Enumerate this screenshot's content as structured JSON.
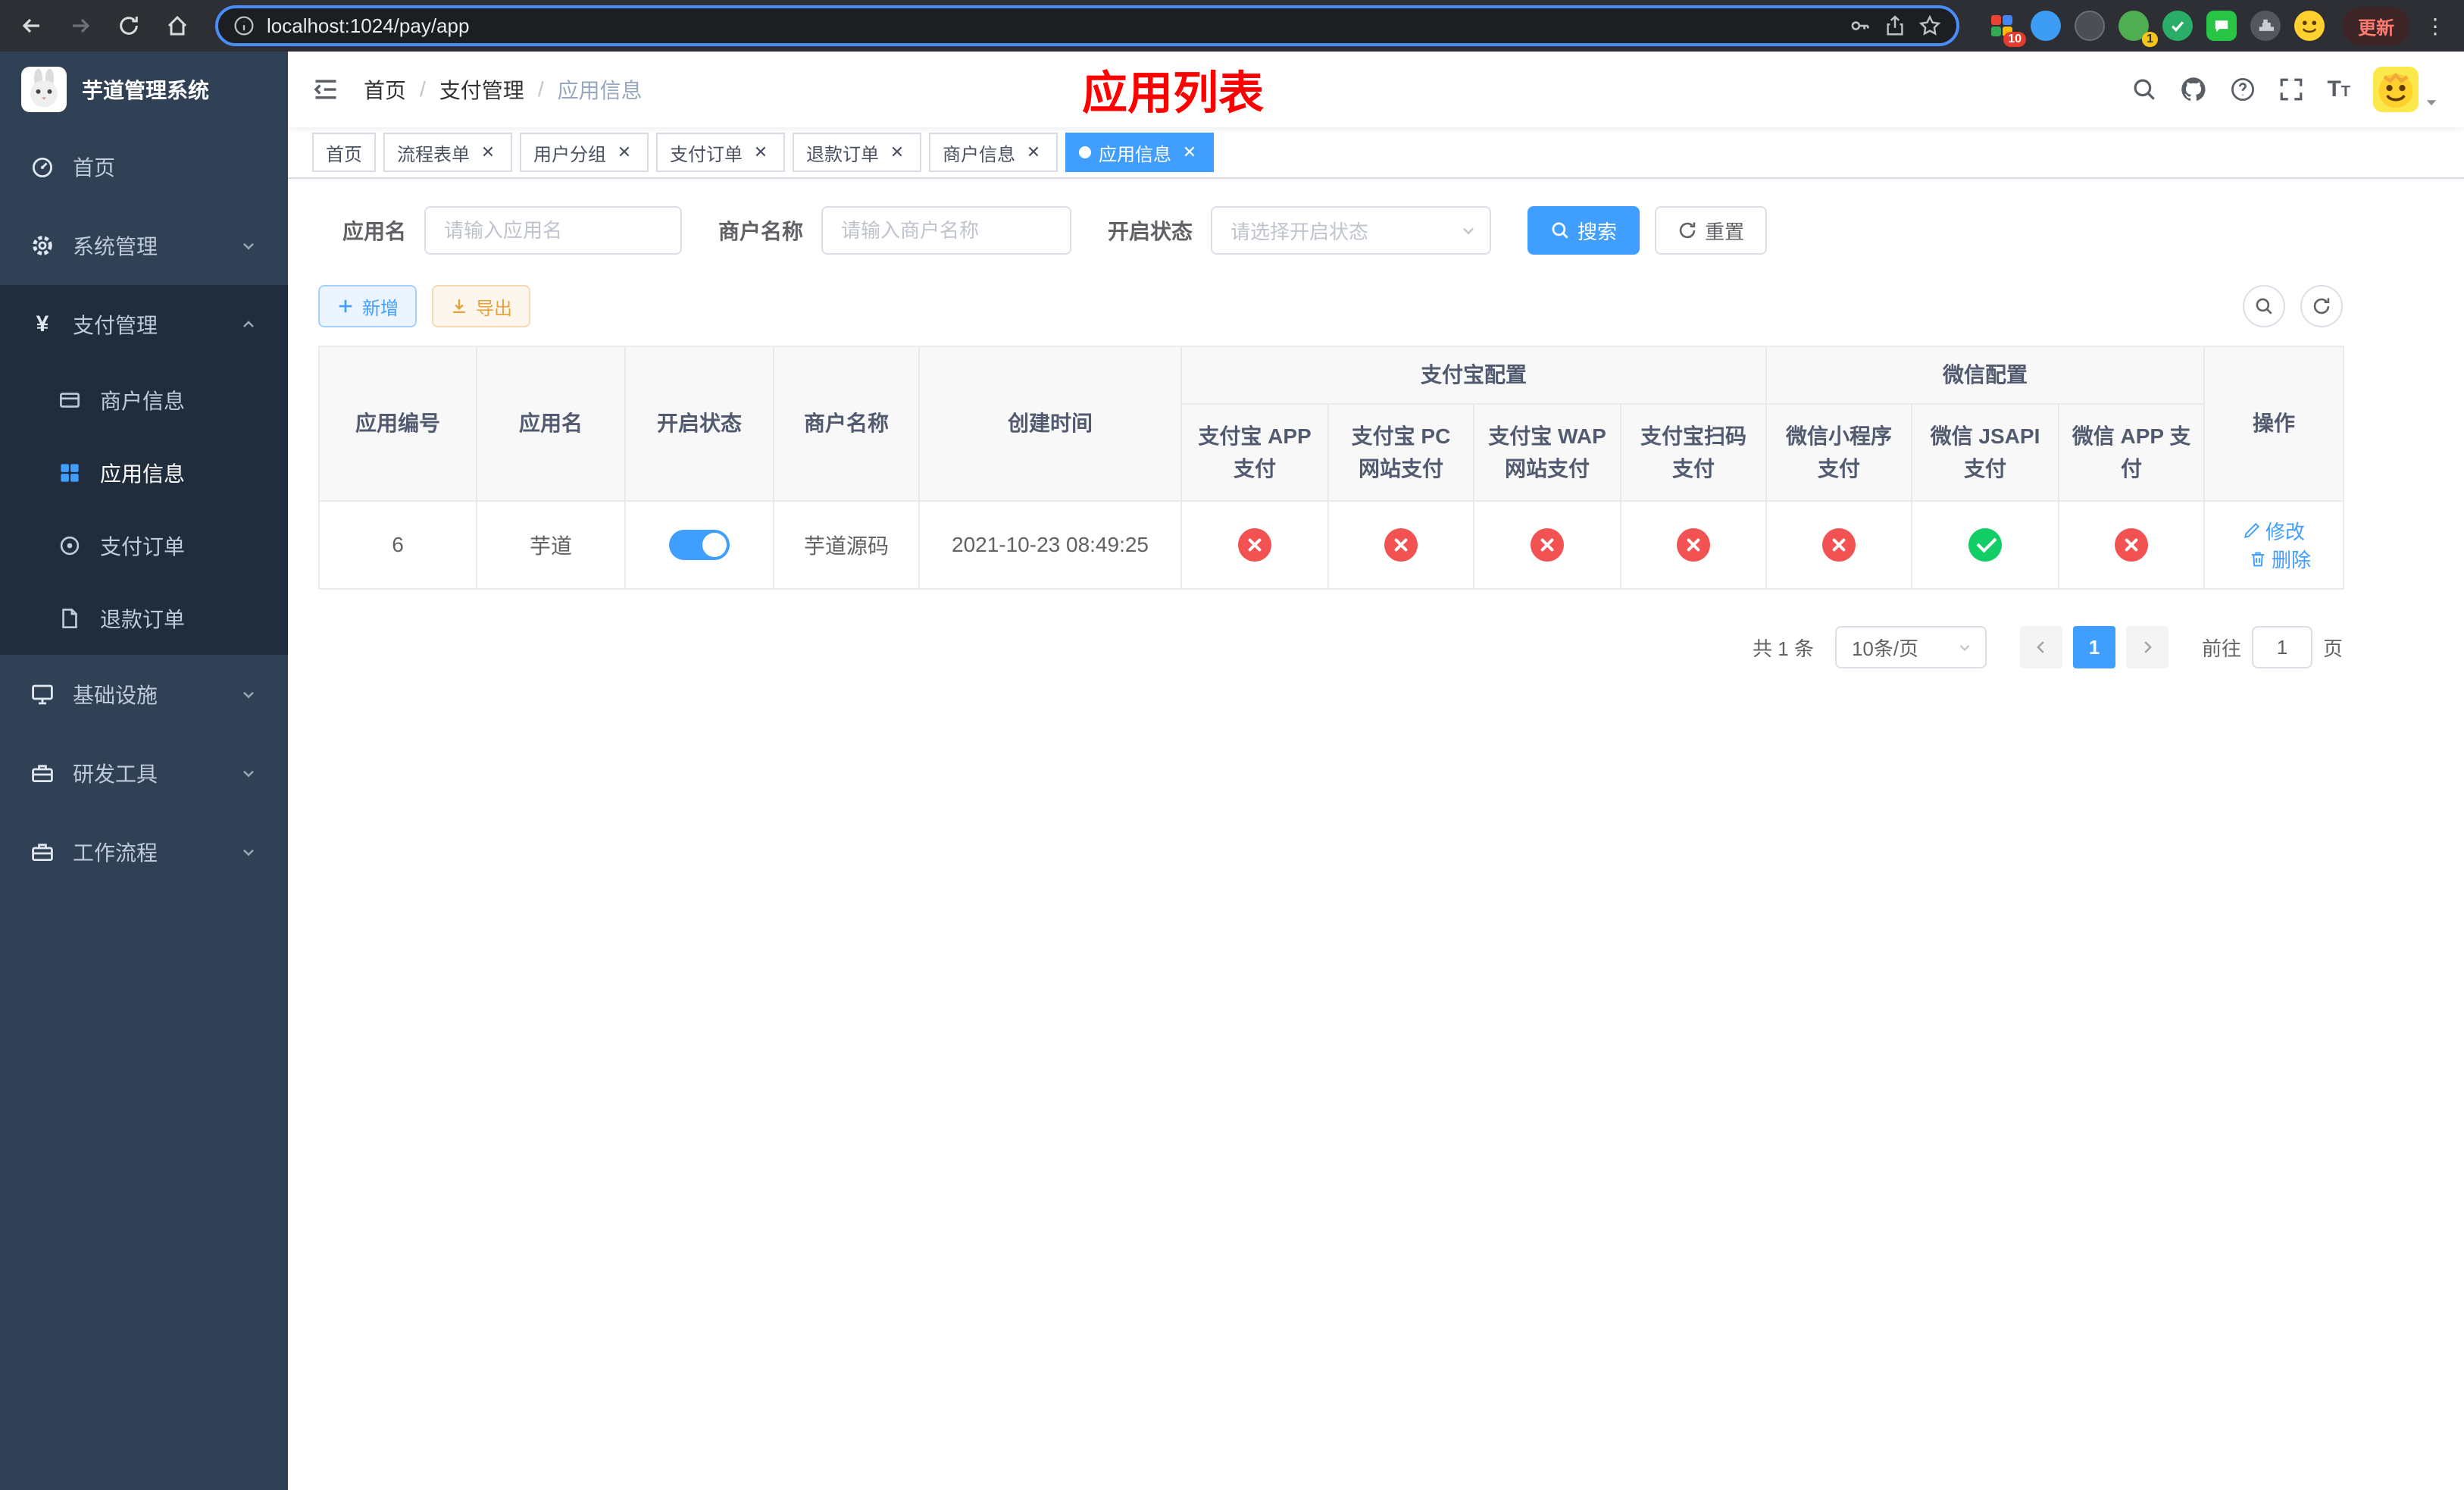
{
  "colors": {
    "accent": "#409eff",
    "danger": "#f35252",
    "success": "#13ce66",
    "warning": "#e6a23c",
    "page_title": "#ff0000",
    "sidebar_bg": "#304156",
    "submenu_bg": "#1f2d3d"
  },
  "browser": {
    "url": "localhost:1024/pay/app",
    "update_label": "更新",
    "extensions_badge": "10",
    "avatar_badge": "1"
  },
  "sidebar": {
    "app_title": "芋道管理系统",
    "items": [
      {
        "label": "首页"
      },
      {
        "label": "系统管理"
      },
      {
        "label": "支付管理"
      },
      {
        "label": "商户信息"
      },
      {
        "label": "应用信息"
      },
      {
        "label": "支付订单"
      },
      {
        "label": "退款订单"
      },
      {
        "label": "基础设施"
      },
      {
        "label": "研发工具"
      },
      {
        "label": "工作流程"
      }
    ]
  },
  "navbar": {
    "breadcrumb": [
      "首页",
      "支付管理",
      "应用信息"
    ],
    "page_title": "应用列表"
  },
  "tabs": [
    {
      "label": "首页",
      "closable": false,
      "active": false
    },
    {
      "label": "流程表单",
      "closable": true,
      "active": false
    },
    {
      "label": "用户分组",
      "closable": true,
      "active": false
    },
    {
      "label": "支付订单",
      "closable": true,
      "active": false
    },
    {
      "label": "退款订单",
      "closable": true,
      "active": false
    },
    {
      "label": "商户信息",
      "closable": true,
      "active": false
    },
    {
      "label": "应用信息",
      "closable": true,
      "active": true
    }
  ],
  "filters": {
    "app_name_label": "应用名",
    "app_name_placeholder": "请输入应用名",
    "merchant_label": "商户名称",
    "merchant_placeholder": "请输入商户名称",
    "status_label": "开启状态",
    "status_placeholder": "请选择开启状态",
    "search_label": "搜索",
    "reset_label": "重置"
  },
  "toolbar": {
    "add_label": "新增",
    "export_label": "导出"
  },
  "table": {
    "headers": {
      "app_id": "应用编号",
      "app_name": "应用名",
      "status": "开启状态",
      "merchant": "商户名称",
      "created": "创建时间",
      "alipay_group": "支付宝配置",
      "alipay_app": "支付宝 APP 支付",
      "alipay_pc": "支付宝 PC 网站支付",
      "alipay_wap": "支付宝 WAP 网站支付",
      "alipay_qr": "支付宝扫码支付",
      "wechat_group": "微信配置",
      "wechat_lite": "微信小程序支付",
      "wechat_jsapi": "微信 JSAPI 支付",
      "wechat_app": "微信 APP 支付",
      "actions": "操作"
    },
    "row": {
      "app_id": "6",
      "app_name": "芋道",
      "status_on": true,
      "merchant": "芋道源码",
      "created": "2021-10-23 08:49:25",
      "configs": [
        false,
        false,
        false,
        false,
        false,
        true,
        false
      ],
      "edit_label": "修改",
      "delete_label": "删除"
    }
  },
  "pagination": {
    "total_label": "共 1 条",
    "page_size_label": "10条/页",
    "current_page": "1",
    "goto_label": "前往",
    "goto_value": "1",
    "page_suffix": "页"
  }
}
